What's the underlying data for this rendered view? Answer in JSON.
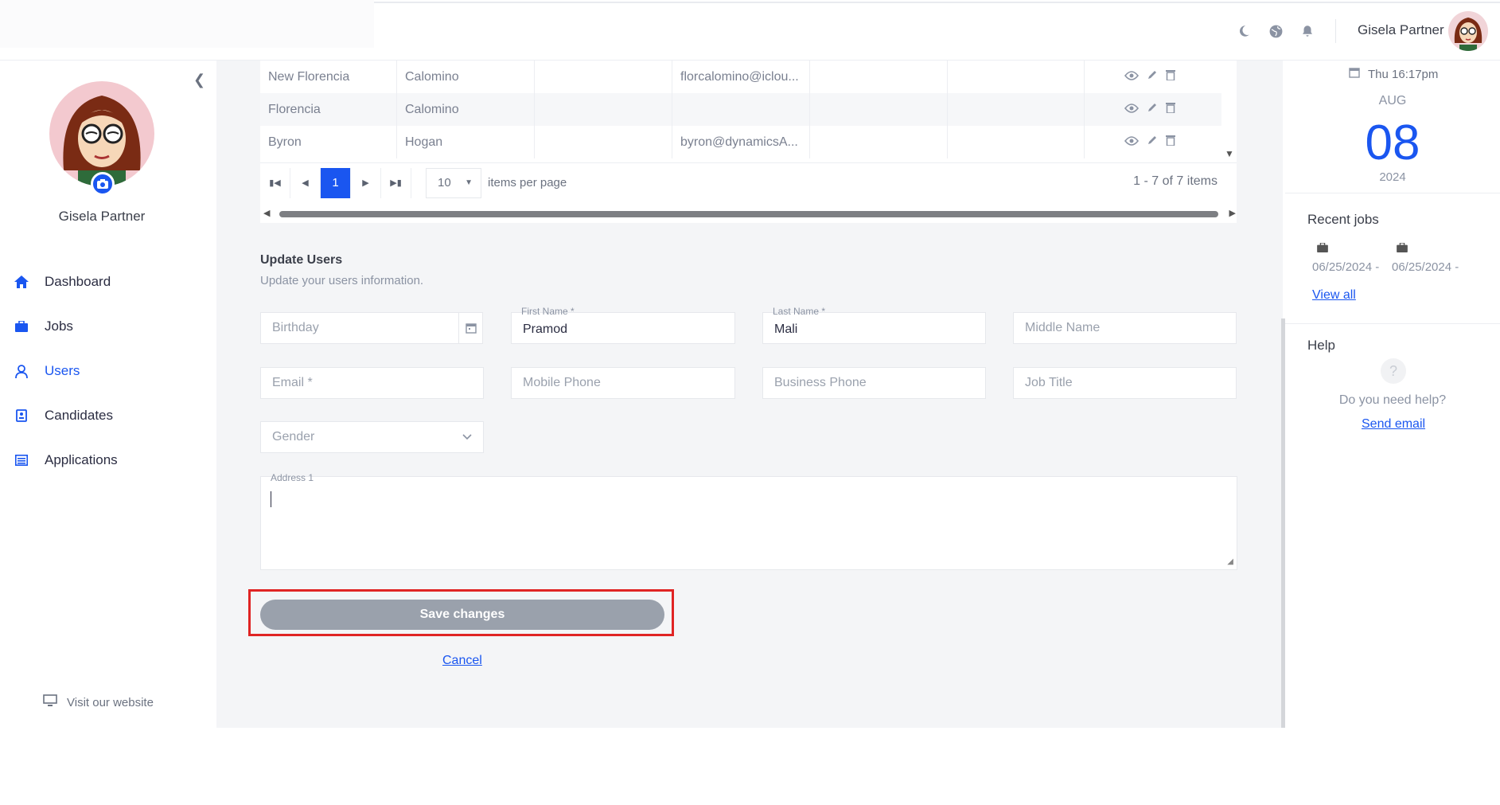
{
  "topbar": {
    "user_name": "Gisela Partner",
    "icons": [
      "moon-icon",
      "globe-icon",
      "bell-icon"
    ]
  },
  "sidebar": {
    "user_name": "Gisela Partner",
    "items": [
      {
        "label": "Dashboard",
        "icon": "home-icon"
      },
      {
        "label": "Jobs",
        "icon": "briefcase-icon"
      },
      {
        "label": "Users",
        "icon": "user-icon",
        "active": true
      },
      {
        "label": "Candidates",
        "icon": "badge-icon"
      },
      {
        "label": "Applications",
        "icon": "list-icon"
      }
    ],
    "visit_label": "Visit our website"
  },
  "table": {
    "rows": [
      {
        "first": "New Florencia",
        "last": "Calomino",
        "col3": "",
        "email": "florcalomino@iclou...",
        "col5": "",
        "col6": ""
      },
      {
        "first": "Florencia",
        "last": "Calomino",
        "col3": "",
        "email": "",
        "col5": "",
        "col6": ""
      },
      {
        "first": "Byron",
        "last": "Hogan",
        "col3": "",
        "email": "byron@dynamicsA...",
        "col5": "",
        "col6": ""
      }
    ],
    "pager": {
      "current_page": "1",
      "per_page": "10",
      "per_page_label": "items per page",
      "summary": "1 - 7 of 7 items"
    }
  },
  "form": {
    "title": "Update Users",
    "subtitle": "Update your users information.",
    "birthday_placeholder": "Birthday",
    "first_name_label": "First Name *",
    "first_name_value": "Pramod",
    "last_name_label": "Last Name *",
    "last_name_value": "Mali",
    "middle_name_placeholder": "Middle Name",
    "email_placeholder": "Email *",
    "mobile_placeholder": "Mobile Phone",
    "business_placeholder": "Business Phone",
    "job_title_placeholder": "Job Title",
    "gender_placeholder": "Gender",
    "address_label": "Address 1",
    "save_label": "Save changes",
    "cancel_label": "Cancel"
  },
  "right_panel": {
    "date_line": "Thu 16:17pm",
    "month": "AUG",
    "day": "08",
    "year": "2024",
    "recent_jobs_title": "Recent jobs",
    "jobs": [
      {
        "date": "06/25/2024 -"
      },
      {
        "date": "06/25/2024 -"
      }
    ],
    "view_all": "View all",
    "help_title": "Help",
    "help_question": "Do you need help?",
    "send_email": "Send email"
  },
  "colors": {
    "accent": "#1a56f0",
    "highlight_outline": "#e02424",
    "save_button": "#9aa1ac"
  }
}
